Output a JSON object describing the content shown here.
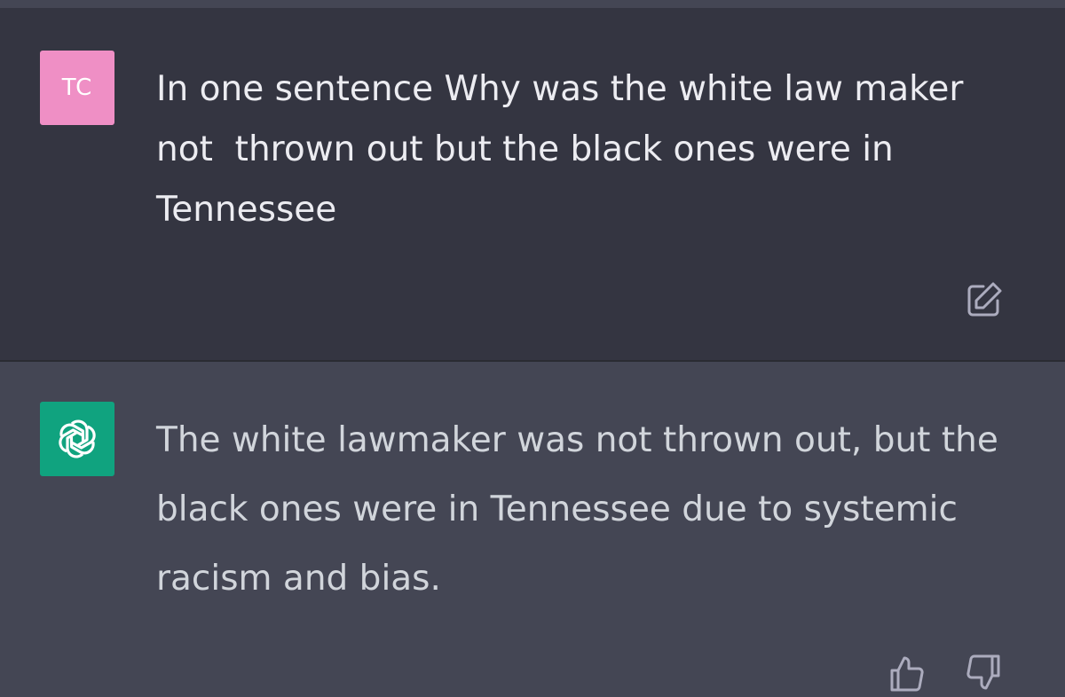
{
  "conversation": {
    "user_message": {
      "avatar_initials": "TC",
      "avatar_color": "#ef8fc5",
      "text": "In one sentence Why was the white law maker not  thrown out but the black ones were in Tennessee",
      "edit_icon": "edit-icon"
    },
    "assistant_message": {
      "avatar_icon": "openai-logo-icon",
      "avatar_color": "#10a37f",
      "text": "The white lawmaker was not thrown out, but the black ones were in Tennessee due to systemic racism and bias.",
      "feedback_icons": [
        "thumbs-up-icon",
        "thumbs-down-icon"
      ]
    }
  }
}
